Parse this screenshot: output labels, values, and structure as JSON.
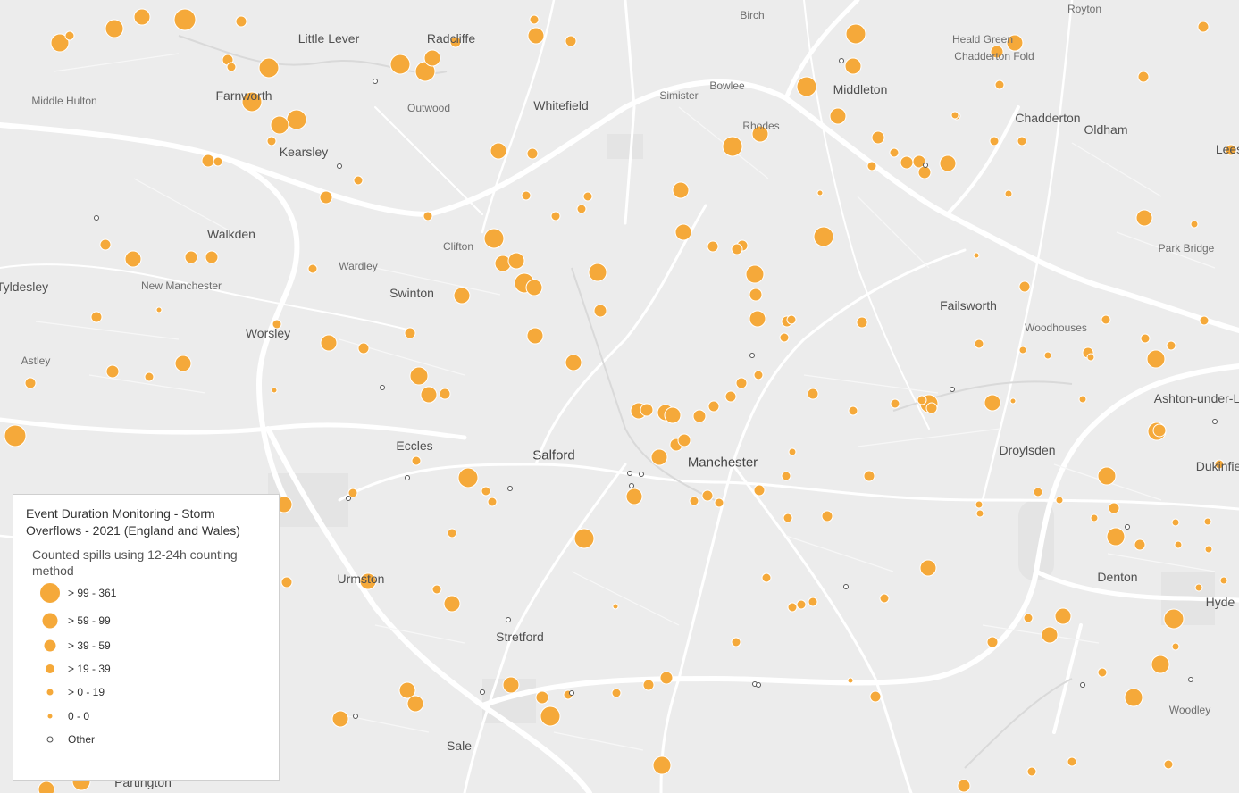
{
  "legend": {
    "title": "Event Duration Monitoring - Storm Overflows - 2021 (England and Wales)",
    "subtitle": "Counted spills using 12-24h counting method",
    "classes": [
      {
        "label": "> 99 - 361"
      },
      {
        "label": "> 59 - 99"
      },
      {
        "label": "> 39 - 59"
      },
      {
        "label": "> 19 - 39"
      },
      {
        "label": "> 0 - 19"
      },
      {
        "label": "0 - 0"
      },
      {
        "label": "Other"
      }
    ]
  },
  "colors": {
    "symbol": "#f5a93a",
    "background": "#ececec",
    "road": "#ffffff"
  },
  "places": [
    "Royton",
    "Birch",
    "Heald Green",
    "Chadderton Fold",
    "Little Lever",
    "Radcliffe",
    "Middle Hulton",
    "Farnworth",
    "Outwood",
    "Whitefield",
    "Simister",
    "Bowlee",
    "Middleton",
    "Rhodes",
    "Chadderton",
    "Oldham",
    "Kearsley",
    "Walkden",
    "Clifton",
    "Wardley",
    "Lees",
    "New Manchester",
    "Tyldesley",
    "Swinton",
    "Park Bridge",
    "Failsworth",
    "Worsley",
    "Woodhouses",
    "Astley",
    "Ashton-under-L",
    "Eccles",
    "Salford",
    "Manchester",
    "Droylsden",
    "Dukinfie",
    "Urmston",
    "Denton",
    "Hyde",
    "Stretford",
    "Woodley",
    "Sale",
    "Partington"
  ]
}
